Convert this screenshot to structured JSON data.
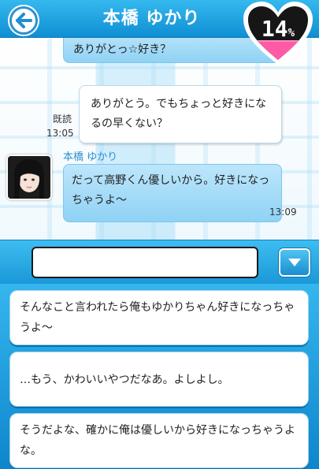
{
  "header": {
    "title": "本橋 ゆかり",
    "affection_value": "14",
    "affection_unit": "%"
  },
  "chat": {
    "messages": [
      {
        "side": "partner",
        "text": "ありがとっ☆好き？"
      },
      {
        "side": "me",
        "text": "ありがとう。でもちょっと好きになるの早くない？",
        "read_label": "既読",
        "time": "13:05"
      },
      {
        "side": "partner",
        "name": "本橋 ゆかり",
        "text": "だって高野くん優しいから。好きになっちゃうよ〜",
        "time": "13:09"
      }
    ]
  },
  "input": {
    "value": "",
    "placeholder": ""
  },
  "choices": [
    {
      "text": "そんなこと言われたら俺もゆかりちゃん好きになっちゃうよ〜"
    },
    {
      "text": "…もう、かわいいやつだなあ。よしよし。"
    },
    {
      "text": "そうだよな、確かに俺は優しいから好きになっちゃうよな。"
    }
  ],
  "colors": {
    "header": "#1fa3e2",
    "bubble_partner": "#a8dcf8",
    "bubble_me": "#ffffff",
    "heart": "#111111",
    "heart_fill": "#ff5aa5"
  },
  "icons": {
    "back": "arrow-left-icon",
    "dropdown": "triangle-down-icon",
    "meter": "heart-icon"
  }
}
